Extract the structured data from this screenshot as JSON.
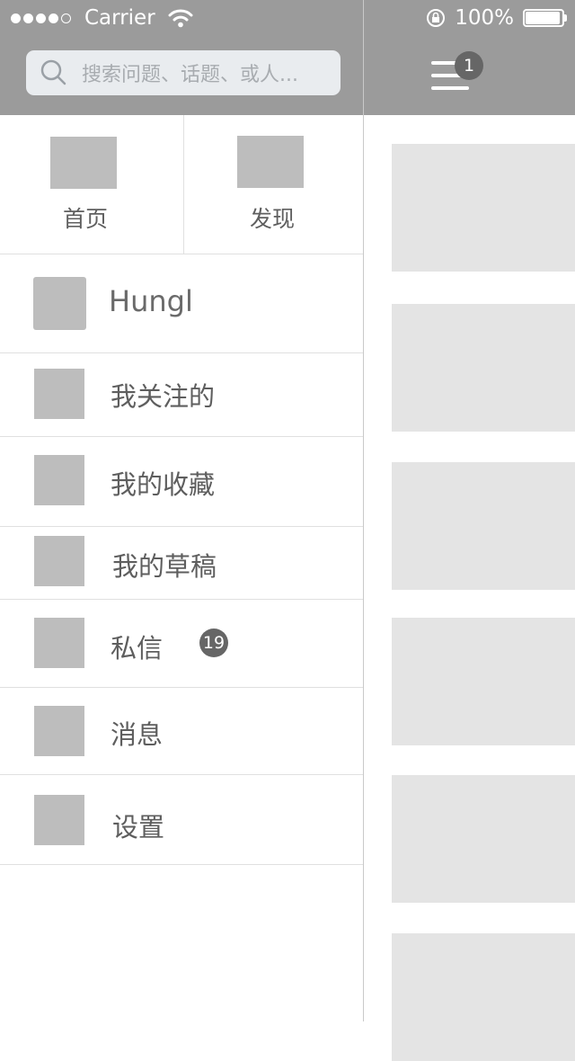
{
  "status_bar": {
    "carrier": "Carrier",
    "battery": "100%"
  },
  "search": {
    "placeholder": "搜索问题、话题、或人..."
  },
  "top_tabs": [
    {
      "label": "首页",
      "icon": "home-icon"
    },
    {
      "label": "发现",
      "icon": "discover-icon"
    }
  ],
  "profile": {
    "name": "Hungl"
  },
  "menu": {
    "items": [
      {
        "label": "我关注的",
        "icon": "following-icon"
      },
      {
        "label": "我的收藏",
        "icon": "favorites-icon"
      },
      {
        "label": "我的草稿",
        "icon": "drafts-icon"
      },
      {
        "label": "私信",
        "icon": "message-icon",
        "badge": "19"
      },
      {
        "label": "消息",
        "icon": "notification-icon"
      },
      {
        "label": "设置",
        "icon": "settings-icon"
      }
    ]
  },
  "header_right": {
    "menu_badge": "1"
  },
  "colors": {
    "header": "#9b9b9b",
    "placeholder_block": "#bdbdbd",
    "card": "#e4e4e4",
    "badge": "#666666"
  }
}
